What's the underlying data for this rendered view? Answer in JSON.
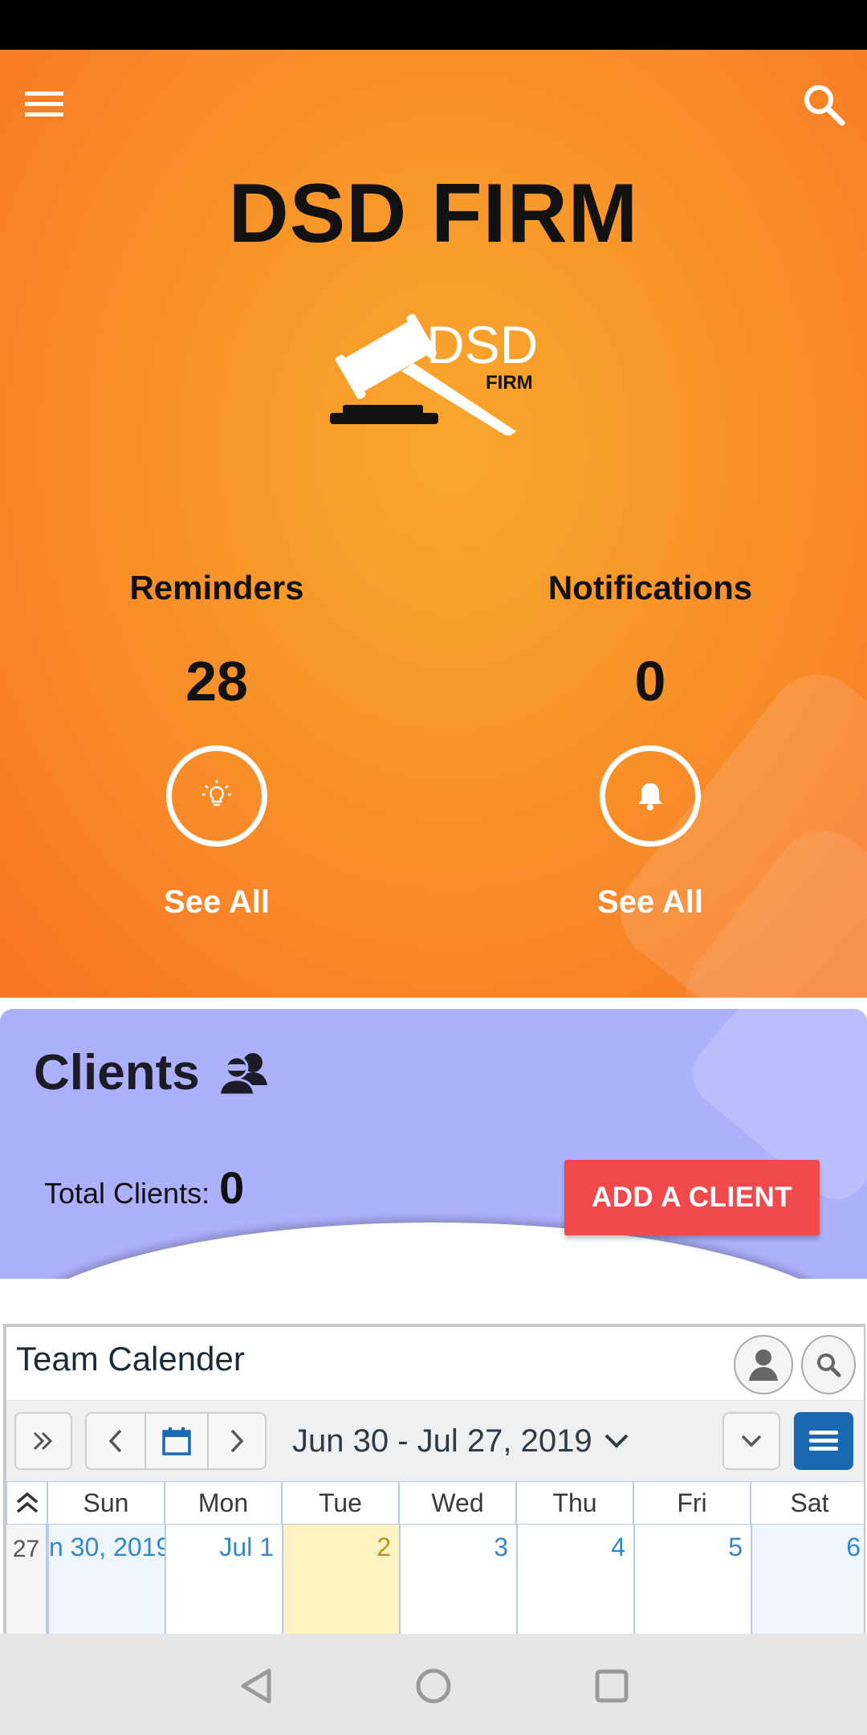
{
  "app": {
    "title": "DSD FIRM",
    "logo_text": "DSD",
    "logo_subtext": "FIRM",
    "accent_color": "#f89a2a"
  },
  "header": {
    "menu_icon": "hamburger-menu-icon",
    "search_icon": "search-icon"
  },
  "stats": {
    "reminders": {
      "label": "Reminders",
      "value": "28",
      "icon": "lightbulb-icon",
      "link": "See All"
    },
    "notifications": {
      "label": "Notifications",
      "value": "0",
      "icon": "bell-icon",
      "link": "See All"
    }
  },
  "clients": {
    "title": "Clients",
    "icon": "users-icon",
    "total_label": "Total Clients:",
    "total_value": "0",
    "add_button": "ADD A CLIENT",
    "card_color": "#adb0fb",
    "button_color": "#f04a4d"
  },
  "calendar": {
    "title": "Team Calender",
    "date_range": "Jun 30 - Jul 27, 2019",
    "week_number": "27",
    "days": [
      {
        "name": "Sun",
        "date": "n 30, 2019"
      },
      {
        "name": "Mon",
        "date": "Jul 1"
      },
      {
        "name": "Tue",
        "date": "2"
      },
      {
        "name": "Wed",
        "date": "3"
      },
      {
        "name": "Thu",
        "date": "4"
      },
      {
        "name": "Fri",
        "date": "5"
      },
      {
        "name": "Sat",
        "date": "6"
      }
    ],
    "today_color": "#fdf2c2",
    "weekend_color": "#eef6fb",
    "menu_button_color": "#1868b2"
  },
  "system_nav": {
    "back_icon": "back-triangle-icon",
    "home_icon": "home-circle-icon",
    "recents_icon": "recents-square-icon"
  }
}
